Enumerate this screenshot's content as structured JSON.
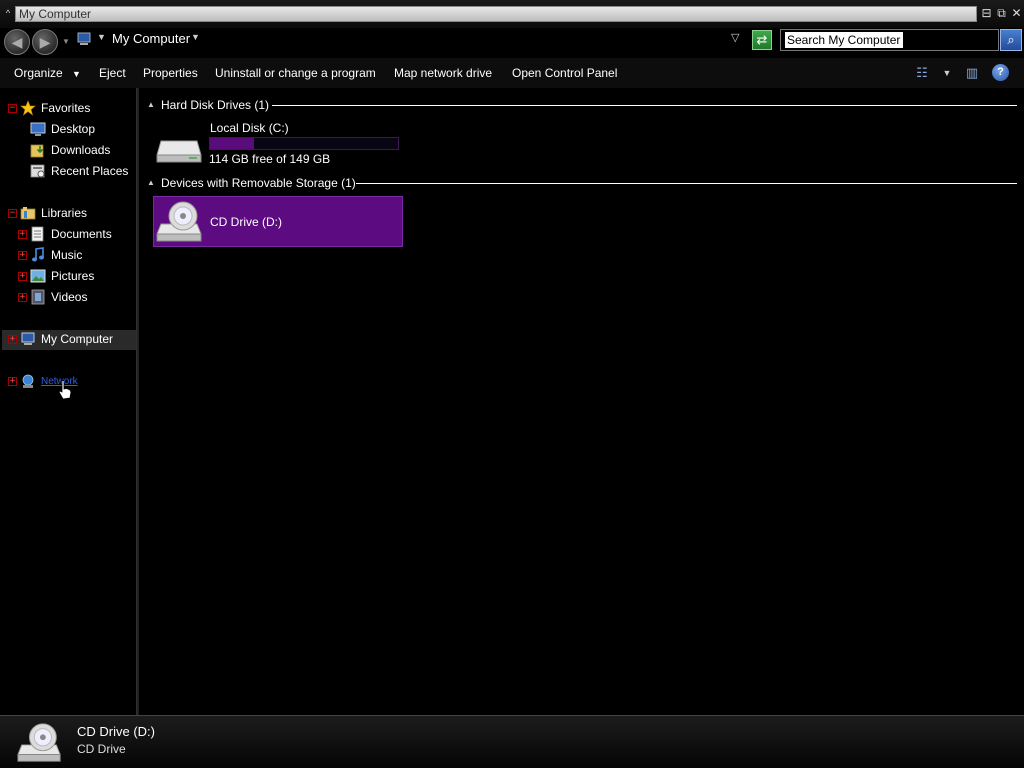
{
  "window": {
    "title": "My Computer",
    "sys_icon": "^",
    "minimize": "⊟",
    "restore": "⧉",
    "close": "✕"
  },
  "address": {
    "back": "◀",
    "forward": "▶",
    "location": "My Computer",
    "search_value": "Search My Computer"
  },
  "toolbar": {
    "organize": "Organize",
    "eject": "Eject",
    "properties": "Properties",
    "uninstall": "Uninstall or change a program",
    "map_drive": "Map network drive",
    "control_panel": "Open Control Panel",
    "help": "?"
  },
  "nav": {
    "favorites": "Favorites",
    "favorites_items": [
      "Desktop",
      "Downloads",
      "Recent Places"
    ],
    "libraries": "Libraries",
    "libraries_items": [
      "Documents",
      "Music",
      "Pictures",
      "Videos"
    ],
    "computer": "My Computer",
    "network": "Network"
  },
  "content": {
    "hard_disk_group": "Hard Disk Drives (1)",
    "removable_group": "Devices with Removable Storage (1)",
    "local_disk": {
      "name": "Local Disk (C:)",
      "info": "114 GB free of 149 GB",
      "used_fraction": 0.235
    },
    "cd_drive": {
      "name": "CD Drive (D:)"
    }
  },
  "details": {
    "name": "CD Drive (D:)",
    "type": "CD Drive"
  },
  "colors": {
    "selection": "#5c0c80",
    "capacity": "#5a0b7c",
    "background": "#000000"
  }
}
